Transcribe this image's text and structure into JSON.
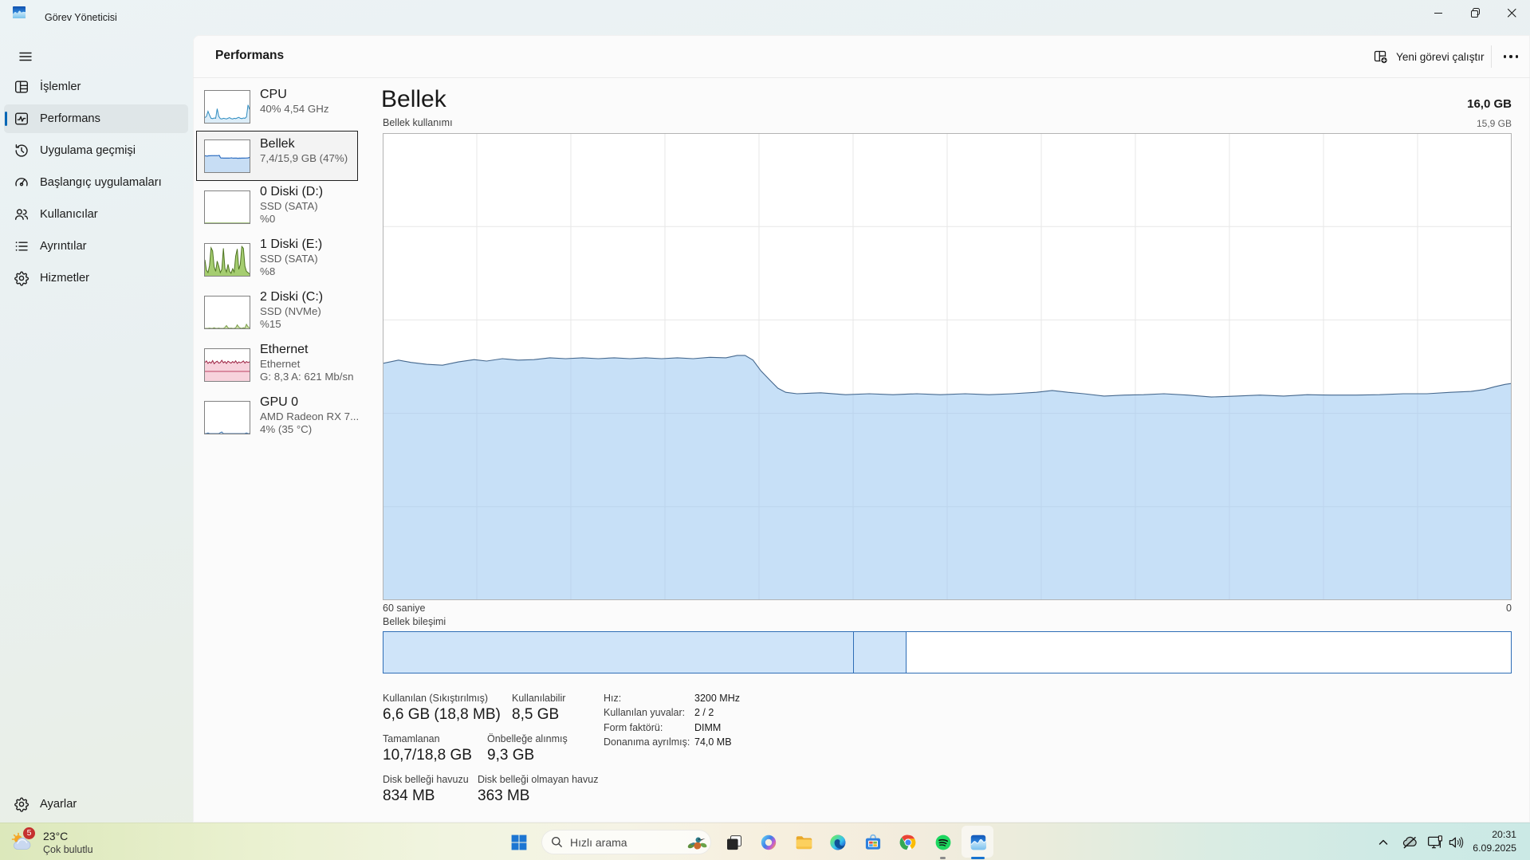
{
  "window": {
    "title": "Görev Yöneticisi",
    "caption_buttons": [
      "minimize",
      "maximize-restore",
      "close"
    ]
  },
  "sidebar": {
    "items": [
      {
        "id": "islemler",
        "label": "İşlemler",
        "icon": "processes-icon",
        "selected": false
      },
      {
        "id": "performans",
        "label": "Performans",
        "icon": "performance-icon",
        "selected": true
      },
      {
        "id": "uygulama-gecmisi",
        "label": "Uygulama geçmişi",
        "icon": "history-icon",
        "selected": false
      },
      {
        "id": "baslangic-uygulamalari",
        "label": "Başlangıç uygulamaları",
        "icon": "startup-icon",
        "selected": false
      },
      {
        "id": "kullanicilar",
        "label": "Kullanıcılar",
        "icon": "users-icon",
        "selected": false
      },
      {
        "id": "ayrintilar",
        "label": "Ayrıntılar",
        "icon": "details-icon",
        "selected": false
      },
      {
        "id": "hizmetler",
        "label": "Hizmetler",
        "icon": "services-icon",
        "selected": false
      }
    ],
    "bottom_item": {
      "id": "ayarlar",
      "label": "Ayarlar",
      "icon": "gear-icon"
    }
  },
  "header": {
    "title": "Performans",
    "run_new_task_label": "Yeni görevi çalıştır",
    "more_label": "..."
  },
  "performance_list": [
    {
      "id": "cpu",
      "title": "CPU",
      "lines": [
        "40% 4,54 GHz"
      ],
      "kind": "cpu",
      "selected": false
    },
    {
      "id": "bellek",
      "title": "Bellek",
      "lines": [
        "7,4/15,9 GB (47%)"
      ],
      "kind": "memory",
      "selected": true
    },
    {
      "id": "disk-d",
      "title": "0 Diski (D:)",
      "lines": [
        "SSD (SATA)",
        "%0"
      ],
      "kind": "disk-idle",
      "selected": false
    },
    {
      "id": "disk-e",
      "title": "1 Diski (E:)",
      "lines": [
        "SSD (SATA)",
        "%8"
      ],
      "kind": "disk-busy",
      "selected": false
    },
    {
      "id": "disk-c",
      "title": "2 Diski (C:)",
      "lines": [
        "SSD (NVMe)",
        "%15"
      ],
      "kind": "disk-low",
      "selected": false
    },
    {
      "id": "ethernet",
      "title": "Ethernet",
      "lines": [
        "Ethernet",
        "G: 8,3 A: 621 Mb/sn"
      ],
      "kind": "ethernet",
      "selected": false
    },
    {
      "id": "gpu0",
      "title": "GPU 0",
      "lines": [
        "AMD Radeon RX 7...",
        "4% (35 °C)"
      ],
      "kind": "gpu",
      "selected": false
    }
  ],
  "memory_page": {
    "title": "Bellek",
    "total": "16,0 GB",
    "usage_label": "Bellek kullanımı",
    "scale_top": "15,9 GB",
    "x_axis_left": "60 saniye",
    "x_axis_right": "0",
    "composition_label": "Bellek bileşimi",
    "stats": [
      {
        "label": "Kullanılan (Sıkıştırılmış)",
        "value": "6,6 GB (18,8 MB)"
      },
      {
        "label": "Kullanılabilir",
        "value": "8,5 GB"
      },
      {
        "label": "Tamamlanan",
        "value": "10,7/18,8 GB"
      },
      {
        "label": "Önbelleğe alınmış",
        "value": "9,3 GB"
      },
      {
        "label": "Disk belleği havuzu",
        "value": "834 MB"
      },
      {
        "label": "Disk belleği olmayan havuz",
        "value": "363 MB"
      }
    ],
    "details": [
      {
        "label": "Hız:",
        "value": "3200 MHz"
      },
      {
        "label": "Kullanılan yuvalar:",
        "value": "2 / 2"
      },
      {
        "label": "Form faktörü:",
        "value": "DIMM"
      },
      {
        "label": "Donanıma ayrılmış:",
        "value": "74,0 MB"
      }
    ]
  },
  "chart_data": {
    "type": "area",
    "title": "Bellek kullanımı",
    "xlabel": "60 saniye -> 0 (son 60 saniye)",
    "ylabel": "Bellek (GB)",
    "ylim": [
      0,
      15.9
    ],
    "total_gb": 16.0,
    "grid": {
      "v_divisions": 12,
      "h_divisions": 5,
      "visible": true
    },
    "legend": "none",
    "series": [
      {
        "name": "used-memory-percent",
        "points": [
          [
            0.0,
            50.7
          ],
          [
            0.014,
            51.4
          ],
          [
            0.025,
            50.9
          ],
          [
            0.039,
            50.5
          ],
          [
            0.053,
            50.3
          ],
          [
            0.067,
            51.0
          ],
          [
            0.081,
            51.5
          ],
          [
            0.092,
            51.2
          ],
          [
            0.106,
            51.7
          ],
          [
            0.12,
            51.4
          ],
          [
            0.134,
            51.5
          ],
          [
            0.148,
            51.9
          ],
          [
            0.162,
            51.7
          ],
          [
            0.177,
            51.9
          ],
          [
            0.191,
            51.7
          ],
          [
            0.205,
            51.9
          ],
          [
            0.219,
            51.7
          ],
          [
            0.233,
            51.9
          ],
          [
            0.247,
            51.7
          ],
          [
            0.261,
            51.9
          ],
          [
            0.275,
            51.7
          ],
          [
            0.29,
            52.0
          ],
          [
            0.304,
            51.9
          ],
          [
            0.314,
            52.4
          ],
          [
            0.321,
            52.4
          ],
          [
            0.328,
            51.4
          ],
          [
            0.335,
            49.1
          ],
          [
            0.343,
            47.1
          ],
          [
            0.35,
            45.4
          ],
          [
            0.357,
            44.5
          ],
          [
            0.367,
            44.2
          ],
          [
            0.388,
            44.4
          ],
          [
            0.41,
            44.0
          ],
          [
            0.431,
            44.2
          ],
          [
            0.452,
            44.0
          ],
          [
            0.473,
            44.2
          ],
          [
            0.494,
            44.0
          ],
          [
            0.516,
            44.2
          ],
          [
            0.537,
            44.0
          ],
          [
            0.558,
            44.2
          ],
          [
            0.579,
            44.5
          ],
          [
            0.593,
            44.9
          ],
          [
            0.607,
            44.5
          ],
          [
            0.621,
            44.2
          ],
          [
            0.639,
            43.7
          ],
          [
            0.657,
            43.9
          ],
          [
            0.674,
            44.0
          ],
          [
            0.692,
            44.2
          ],
          [
            0.713,
            43.9
          ],
          [
            0.734,
            43.5
          ],
          [
            0.756,
            43.7
          ],
          [
            0.777,
            43.9
          ],
          [
            0.798,
            43.7
          ],
          [
            0.819,
            44.0
          ],
          [
            0.84,
            43.9
          ],
          [
            0.862,
            43.9
          ],
          [
            0.883,
            44.0
          ],
          [
            0.904,
            44.2
          ],
          [
            0.925,
            44.2
          ],
          [
            0.946,
            44.5
          ],
          [
            0.964,
            44.7
          ],
          [
            0.976,
            45.1
          ],
          [
            0.985,
            45.7
          ],
          [
            0.994,
            46.2
          ],
          [
            1.0,
            46.4
          ]
        ]
      }
    ],
    "composition_bar": {
      "label": "Bellek bileşimi",
      "segments": [
        {
          "name": "in-use",
          "width_pct": 41.7,
          "filled": true
        },
        {
          "name": "modified",
          "width_pct": 4.7,
          "filled": true
        },
        {
          "name": "standby-free",
          "width_pct": 53.6,
          "filled": false
        }
      ]
    },
    "sparklines": {
      "cpu": [
        16,
        20,
        36,
        24,
        14,
        13,
        15,
        14,
        44,
        20,
        13,
        12,
        14,
        13,
        12,
        14,
        16,
        13,
        12,
        14,
        13,
        15,
        17,
        14,
        13,
        15,
        14,
        18,
        56,
        42
      ],
      "disk_idle": [
        1,
        1,
        1,
        1,
        1,
        1,
        1,
        1,
        1,
        1,
        1,
        1,
        1,
        1,
        1,
        1,
        1,
        1,
        1,
        1,
        1,
        1,
        1,
        1,
        1,
        1,
        1,
        1,
        1,
        1
      ],
      "disk_busy": [
        50,
        18,
        10,
        32,
        88,
        78,
        28,
        14,
        46,
        30,
        10,
        20,
        86,
        24,
        12,
        36,
        14,
        8,
        22,
        12,
        62,
        84,
        20,
        36,
        92,
        86,
        30,
        14,
        10,
        6
      ],
      "disk_low": [
        0,
        0,
        0,
        1,
        0,
        0,
        2,
        0,
        0,
        1,
        0,
        0,
        0,
        3,
        9,
        2,
        0,
        1,
        0,
        0,
        2,
        11,
        4,
        1,
        0,
        2,
        1,
        13,
        5,
        2
      ],
      "ethernet": [
        58,
        63,
        55,
        60,
        56,
        64,
        54,
        59,
        62,
        56,
        58,
        65,
        57,
        61,
        55,
        62,
        59,
        56,
        61,
        57,
        63,
        55,
        60,
        57,
        59,
        63,
        56,
        61,
        58,
        60
      ],
      "ethernet_secondary_level": 30,
      "gpu": [
        0,
        0,
        2,
        0,
        0,
        0,
        0,
        0,
        0,
        0,
        3,
        5,
        0,
        0,
        0,
        0,
        0,
        0,
        0,
        0,
        0,
        0,
        0,
        0,
        0,
        0,
        0,
        2,
        0,
        0
      ]
    },
    "colors": {
      "memory_line": "#45688e",
      "memory_fill": "#c7dcf2",
      "cpu_line": "#2f8cc0",
      "disk_line": "#557a28",
      "ethernet_line": "#9b2242",
      "composition_border": "#2e6db6",
      "composition_fill": "#cfe4f9",
      "accent": "#0867b6"
    }
  },
  "taskbar": {
    "weather": {
      "badge": "5",
      "temperature": "23°C",
      "condition": "Çok bulutlu"
    },
    "search": {
      "placeholder": "Hızlı arama"
    },
    "apps": [
      {
        "id": "task-view",
        "icon": "task-view-icon",
        "running": false,
        "active": false
      },
      {
        "id": "copilot",
        "icon": "copilot-icon",
        "running": false,
        "active": false
      },
      {
        "id": "explorer",
        "icon": "file-explorer-icon",
        "running": false,
        "active": false
      },
      {
        "id": "edge",
        "icon": "edge-icon",
        "running": false,
        "active": false
      },
      {
        "id": "store",
        "icon": "store-icon",
        "running": false,
        "active": false
      },
      {
        "id": "chrome",
        "icon": "chrome-icon",
        "running": false,
        "active": false
      },
      {
        "id": "spotify",
        "icon": "spotify-icon",
        "running": true,
        "active": false
      },
      {
        "id": "task-manager",
        "icon": "task-manager-icon",
        "running": true,
        "active": true
      }
    ],
    "tray": {
      "icons": [
        "chevron-up-icon",
        "onedrive-paused-icon",
        "network-icon",
        "volume-icon"
      ],
      "time": "20:31",
      "date": "6.09.2025"
    }
  }
}
